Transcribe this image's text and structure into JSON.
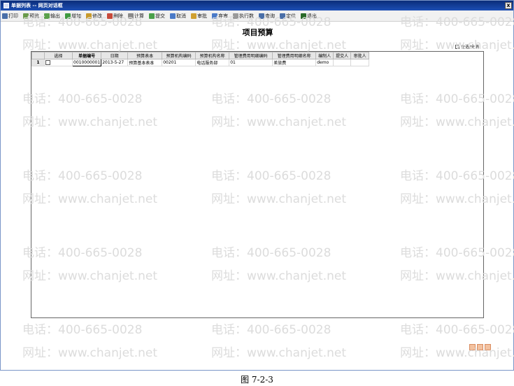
{
  "window": {
    "title": "单据列表 -- 网页对话框",
    "close_label": "x"
  },
  "toolbar": {
    "buttons": [
      {
        "label": "打印",
        "icon": "print-icon",
        "color": "#4a6fa8"
      },
      {
        "label": "预览",
        "icon": "preview-icon",
        "color": "#6a9a4a"
      },
      {
        "label": "输出",
        "icon": "export-icon",
        "color": "#5aa04a"
      },
      {
        "label": "增加",
        "icon": "add-icon",
        "color": "#3f9a3f"
      },
      {
        "label": "修改",
        "icon": "edit-icon",
        "color": "#c89a2a"
      },
      {
        "label": "删除",
        "icon": "delete-icon",
        "color": "#c84a3a"
      },
      {
        "label": "计算",
        "icon": "calculate-icon",
        "color": "#8a8a8a"
      },
      {
        "label": "提交",
        "icon": "submit-icon",
        "color": "#4aa04a"
      },
      {
        "label": "取消",
        "icon": "cancel-icon",
        "color": "#4a7ac8"
      },
      {
        "label": "审批",
        "icon": "approve-icon",
        "color": "#d0a030"
      },
      {
        "label": "弃审",
        "icon": "unapprove-icon",
        "color": "#4a7ac8"
      },
      {
        "label": "执行数",
        "icon": "execute-icon",
        "color": "#9a9a9a"
      },
      {
        "label": "查询",
        "icon": "query-icon",
        "color": "#4a6fa8"
      },
      {
        "label": "定位",
        "icon": "locate-icon",
        "color": "#4a6fa8"
      },
      {
        "label": "退出",
        "icon": "exit-icon",
        "color": "#2a6a2a"
      }
    ]
  },
  "page": {
    "title": "项目预算",
    "select_all_label": "全选/全消"
  },
  "table": {
    "columns": [
      "",
      "选择",
      "单据编号",
      "日期",
      "预算表本",
      "预算机构编码",
      "预算机构名称",
      "管理费用明细编码",
      "管理费用明细名称",
      "编制人",
      "提交人",
      "审批人"
    ],
    "rows": [
      {
        "row_no": "1",
        "doc_no": "0010000001",
        "date": "2013-5-27",
        "budget": "预算基本表本",
        "org_code": "00201",
        "org_name": "电话服务部",
        "expense_code": "01",
        "expense_name": "差旅费",
        "maker": "demo",
        "submitter": "",
        "approver": ""
      }
    ]
  },
  "watermark": {
    "phone": "电话：400-665-0028",
    "site": "网址：www.chanjet.net"
  },
  "caption": "图 7-2-3"
}
